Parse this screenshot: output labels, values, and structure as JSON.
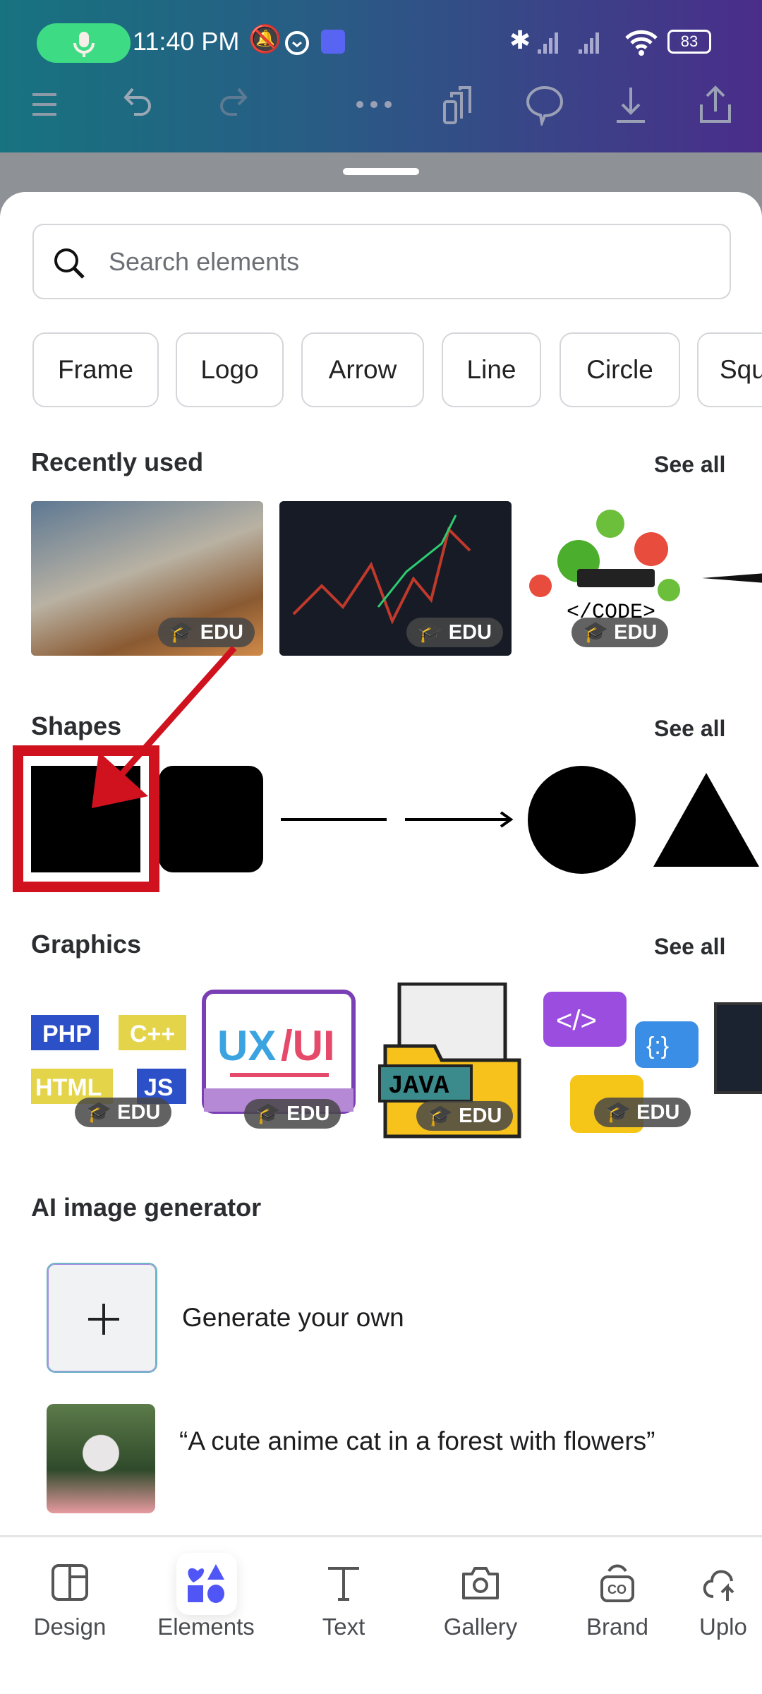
{
  "status_bar": {
    "time": "11:40 PM",
    "battery": "83"
  },
  "toolbar": {
    "icons": [
      "menu-icon",
      "undo-icon",
      "redo-icon",
      "more-icon",
      "pages-icon",
      "comment-icon",
      "download-icon",
      "share-icon"
    ]
  },
  "search": {
    "placeholder": "Search elements",
    "value": ""
  },
  "chips": [
    "Frame",
    "Logo",
    "Arrow",
    "Line",
    "Circle",
    "Squ"
  ],
  "recently_used": {
    "title": "Recently used",
    "see_all": "See all",
    "badge": "EDU",
    "items": [
      "coins-network",
      "stock-chart",
      "code-html-css-php"
    ]
  },
  "shapes": {
    "title": "Shapes",
    "see_all": "See all",
    "items": [
      "square",
      "rounded-square",
      "line",
      "arrow-line",
      "circle",
      "triangle"
    ]
  },
  "graphics": {
    "title": "Graphics",
    "see_all": "See all",
    "badge": "EDU",
    "items": [
      "php-cpp-html-js",
      "ux-ui",
      "java-folder",
      "code-bubbles"
    ]
  },
  "ai_generator": {
    "title": "AI image generator",
    "generate": "Generate your own",
    "prompt": "“A cute anime cat in a forest with flowers”"
  },
  "bottom_nav": {
    "items": [
      "Design",
      "Elements",
      "Text",
      "Gallery",
      "Brand",
      "Uplo"
    ],
    "active": "Elements",
    "active_color": "#4f56f5"
  },
  "highlight_color": "#d0121f"
}
